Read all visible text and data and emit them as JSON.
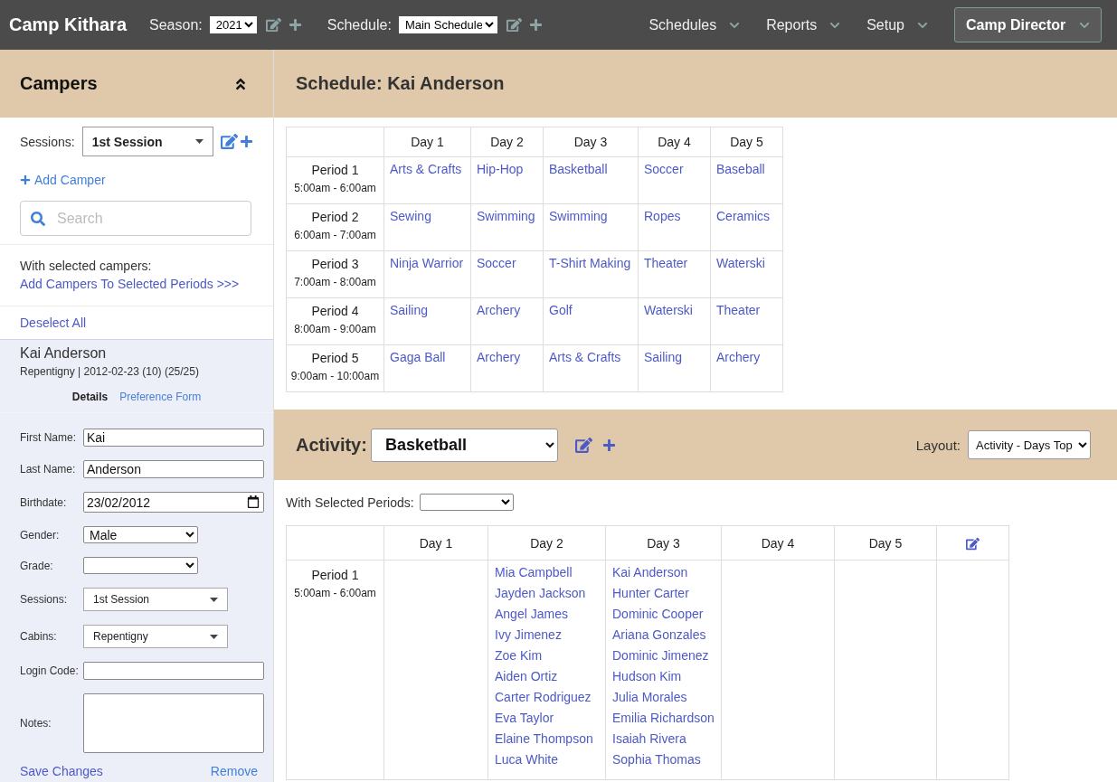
{
  "top_bar": {
    "brand": "Camp Kithara",
    "season": {
      "label": "Season:",
      "value": "2021"
    },
    "schedule": {
      "label": "Schedule:",
      "value": "Main Schedule"
    },
    "menus": [
      {
        "label": "Schedules"
      },
      {
        "label": "Reports"
      },
      {
        "label": "Setup"
      }
    ],
    "user_menu": {
      "label": "Camp Director"
    }
  },
  "sidebar": {
    "title": "Campers",
    "sessions": {
      "label": "Sessions:",
      "value": "1st Session"
    },
    "add_camper": "Add Camper",
    "search": {
      "placeholder": "Search"
    },
    "bulk": {
      "label": "With selected campers:",
      "link": "Add Campers To Selected Periods >>>"
    },
    "deselect_all": "Deselect All",
    "camper": {
      "name": "Kai Anderson",
      "details": "Repentigny | 2012-02-23 (10) (25/25)",
      "tabs": [
        {
          "label": "Details",
          "selected": true
        },
        {
          "label": "Preference Form",
          "selected": false
        }
      ]
    },
    "form": {
      "fields": [
        {
          "kind": "text",
          "label": "First Name:",
          "value": "Kai"
        },
        {
          "kind": "text",
          "label": "Last Name:",
          "value": "Anderson"
        },
        {
          "kind": "date",
          "label": "Birthdate:",
          "value": "23/02/2012"
        },
        {
          "kind": "select",
          "label": "Gender:",
          "value": "Male"
        },
        {
          "kind": "select",
          "label": "Grade:"
        },
        {
          "kind": "dropdown",
          "label": "Sessions:",
          "value": "1st Session"
        },
        {
          "kind": "dropdown",
          "label": "Cabins:",
          "value": "Repentigny"
        },
        {
          "kind": "text",
          "label": "Login Code:"
        },
        {
          "kind": "textarea",
          "label": "Notes:"
        }
      ]
    },
    "actions": {
      "save": "Save Changes",
      "remove": "Remove"
    }
  },
  "schedule": {
    "title": "Schedule: Kai Anderson",
    "columns": [
      "Day 1",
      "Day 2",
      "Day 3",
      "Day 4",
      "Day 5"
    ],
    "rows": [
      {
        "period": "Period 1",
        "time": "5:00am - 6:00am",
        "activities": [
          "Arts & Crafts",
          "Hip-Hop",
          "Basketball",
          "Soccer",
          "Baseball"
        ]
      },
      {
        "period": "Period 2",
        "time": "6:00am - 7:00am",
        "activities": [
          "Sewing",
          "Swimming",
          "Swimming",
          "Ropes",
          "Ceramics"
        ]
      },
      {
        "period": "Period 3",
        "time": "7:00am - 8:00am",
        "activities": [
          "Ninja Warrior",
          "Soccer",
          "T-Shirt Making",
          "Theater",
          "Waterski"
        ]
      },
      {
        "period": "Period 4",
        "time": "8:00am - 9:00am",
        "activities": [
          "Sailing",
          "Archery",
          "Golf",
          "Waterski",
          "Theater"
        ]
      },
      {
        "period": "Period 5",
        "time": "9:00am - 10:00am",
        "activities": [
          "Gaga Ball",
          "Archery",
          "Arts & Crafts",
          "Sailing",
          "Archery"
        ]
      }
    ]
  },
  "activity": {
    "label": "Activity:",
    "value": "Basketball",
    "layout": {
      "label": "Layout:",
      "value": "Activity - Days Top"
    },
    "bulk": {
      "label": "With Selected Periods:"
    },
    "columns": [
      "Day 1",
      "Day 2",
      "Day 3",
      "Day 4",
      "Day 5"
    ],
    "rows": [
      {
        "period": "Period 1",
        "time": "5:00am - 6:00am",
        "cells": [
          {},
          {
            "campers": [
              "Mia Campbell",
              "Jayden Jackson",
              "Angel James",
              "Ivy Jimenez",
              "Zoe Kim",
              "Aiden Ortiz",
              "Carter Rodriguez",
              "Eva Taylor",
              "Elaine Thompson",
              "Luca White"
            ]
          },
          {
            "campers": [
              "Kai Anderson",
              "Hunter Carter",
              "Dominic Cooper",
              "Ariana Gonzales",
              "Dominic Jimenez",
              "Hudson Kim",
              "Julia Morales",
              "Emilia Richardson",
              "Isaiah Rivera",
              "Sophia Thomas"
            ]
          },
          {},
          {}
        ]
      }
    ]
  }
}
